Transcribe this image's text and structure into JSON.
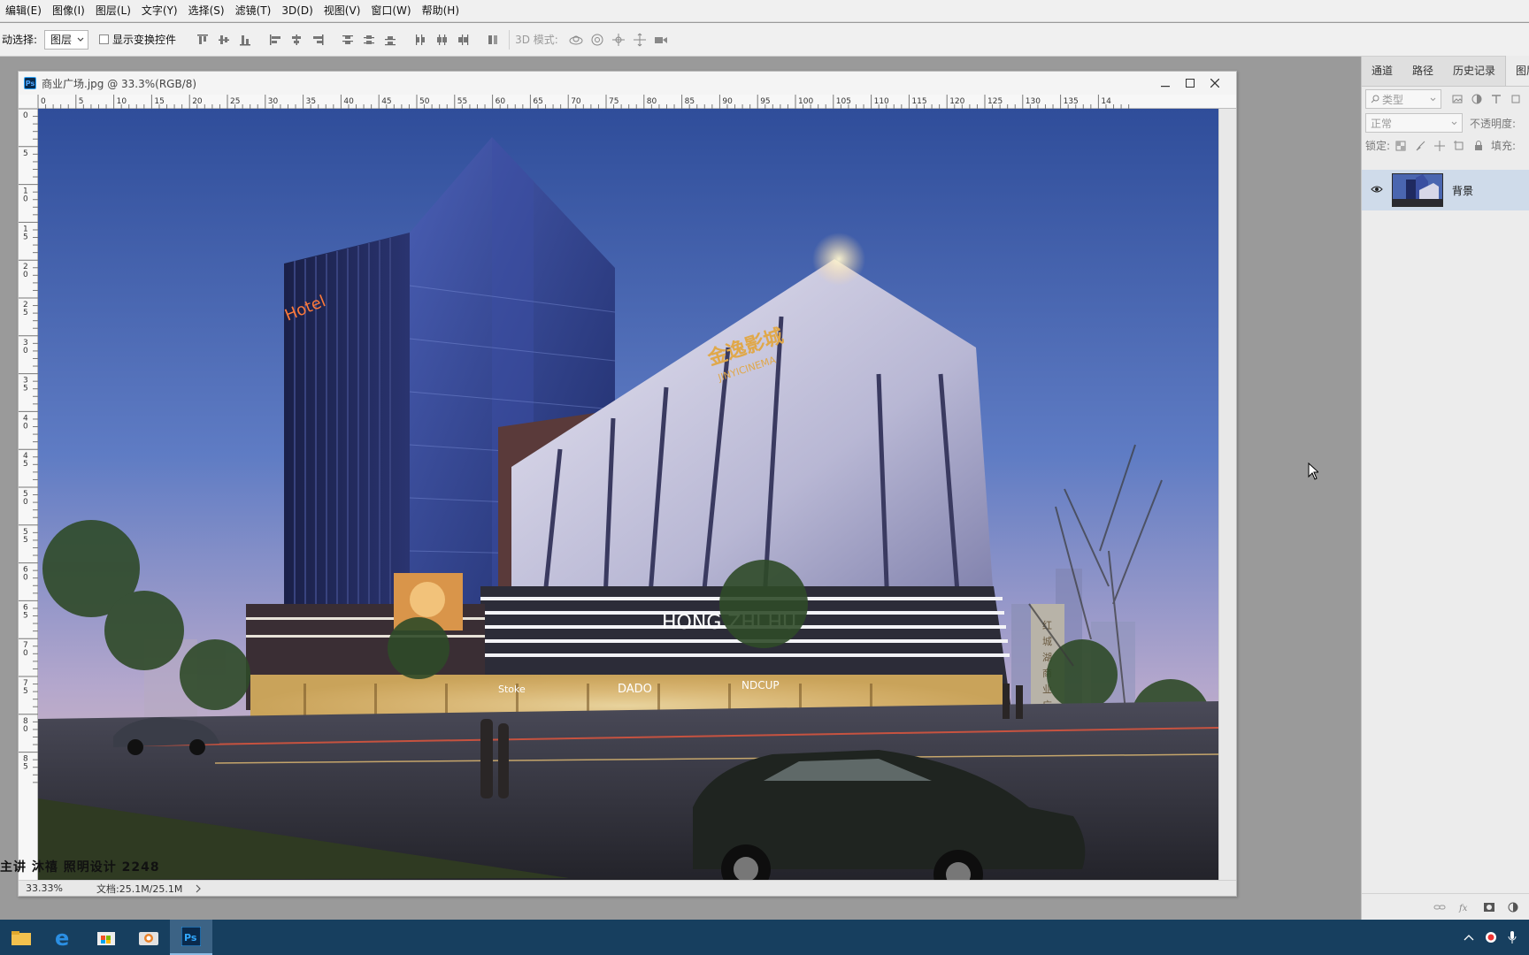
{
  "menus": [
    "编辑(E)",
    "图像(I)",
    "图层(L)",
    "文字(Y)",
    "选择(S)",
    "滤镜(T)",
    "3D(D)",
    "视图(V)",
    "窗口(W)",
    "帮助(H)"
  ],
  "options_bar": {
    "auto_select_label": "动选择:",
    "auto_select_value": "图层",
    "show_transform_label": "显示变换控件",
    "mode_3d_label": "3D 模式:"
  },
  "document": {
    "title": "商业广场.jpg @ 33.3%(RGB/8)",
    "hruler_ticks": [
      "0",
      "5",
      "10",
      "15",
      "20",
      "25",
      "30",
      "35",
      "40",
      "45",
      "50",
      "55",
      "60",
      "65",
      "70",
      "75",
      "80",
      "85",
      "90",
      "95",
      "100",
      "105",
      "110",
      "115",
      "120",
      "125",
      "130",
      "135",
      "14"
    ],
    "vruler_ticks": [
      "0",
      "5",
      "10",
      "15",
      "20",
      "25",
      "30",
      "35",
      "40",
      "45",
      "50",
      "55",
      "60",
      "65",
      "70",
      "75",
      "80",
      "85"
    ],
    "zoom": "33.33%",
    "doc_info": "文档:25.1M/25.1M",
    "image_text": {
      "hotel_sign": "Hotel",
      "cinema_sign": "金逸影城",
      "cinema_sub": "JINYICINEMA",
      "facade_sign": "HONG ZHI HU",
      "shop_1": "DADO",
      "shop_2": "NDCUP",
      "shop_3": "Stoke",
      "pylon": [
        "红",
        "城",
        "湖",
        "商",
        "业",
        "广",
        "场"
      ]
    }
  },
  "layers_panel": {
    "tabs": [
      "通道",
      "路径",
      "历史记录",
      "图层"
    ],
    "filter_placeholder": "类型",
    "blend_mode": "正常",
    "opacity_label": "不透明度:",
    "lock_label": "锁定:",
    "fill_label": "填充:",
    "layers": [
      {
        "name": "背景",
        "visible": true
      }
    ]
  },
  "watermark": "主讲 沐禧 照明设计 2248"
}
